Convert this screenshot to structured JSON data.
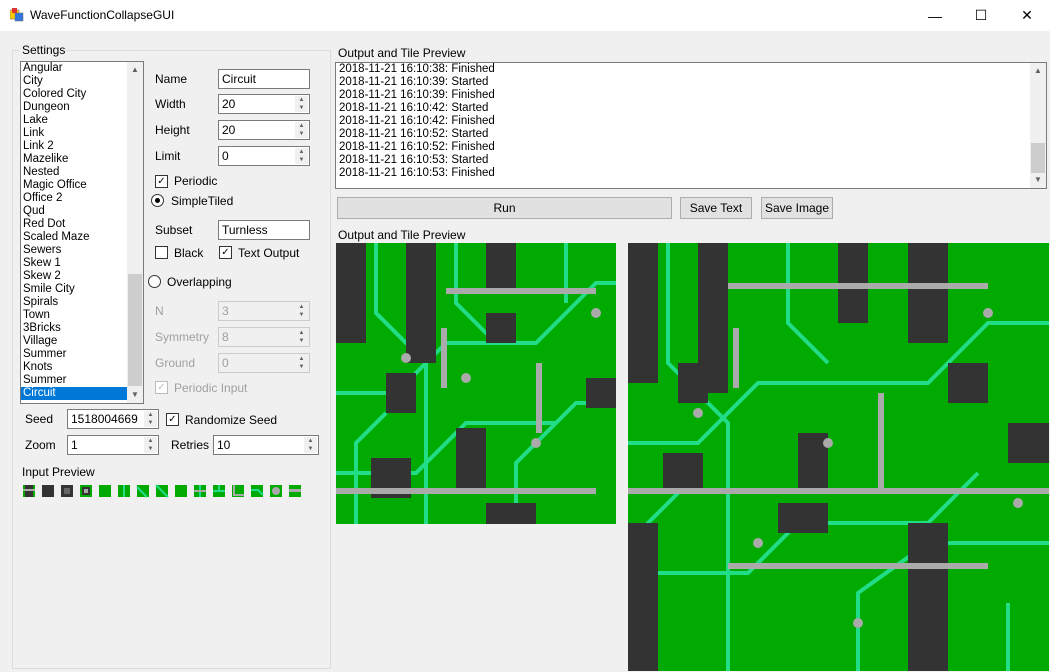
{
  "window": {
    "title": "WaveFunctionCollapseGUI",
    "minimize": "—",
    "maximize": "☐",
    "close": "✕"
  },
  "settings": {
    "group_label": "Settings",
    "list_items": [
      "Angular",
      "City",
      "Colored City",
      "Dungeon",
      "Lake",
      "Link",
      "Link 2",
      "Mazelike",
      "Nested",
      "Magic Office",
      "Office 2",
      "Qud",
      "Red Dot",
      "Scaled Maze",
      "Sewers",
      "Skew 1",
      "Skew 2",
      "Smile City",
      "Spirals",
      "Town",
      "3Bricks",
      "Village",
      "Summer",
      "Knots",
      "Summer",
      "Circuit"
    ],
    "selected_item": "Circuit",
    "name_label": "Name",
    "name_value": "Circuit",
    "width_label": "Width",
    "width_value": "20",
    "height_label": "Height",
    "height_value": "20",
    "limit_label": "Limit",
    "limit_value": "0",
    "periodic_label": "Periodic",
    "periodic_checked": "✓",
    "simpletiled_label": "SimpleTiled",
    "subset_label": "Subset",
    "subset_value": "Turnless",
    "black_label": "Black",
    "text_output_label": "Text Output",
    "text_output_checked": "✓",
    "overlapping_label": "Overlapping",
    "n_label": "N",
    "n_value": "3",
    "symmetry_label": "Symmetry",
    "symmetry_value": "8",
    "ground_label": "Ground",
    "ground_value": "0",
    "periodic_input_label": "Periodic Input",
    "periodic_input_checked": "✓",
    "seed_label": "Seed",
    "seed_value": "1518004669",
    "randomize_seed_label": "Randomize Seed",
    "randomize_seed_checked": "✓",
    "zoom_label": "Zoom",
    "zoom_value": "1",
    "retries_label": "Retries",
    "retries_value": "10",
    "input_preview_label": "Input Preview"
  },
  "output": {
    "group_label": "Output and Tile Preview",
    "log_lines": [
      "2018-11-21 16:10:38: Finished",
      "2018-11-21 16:10:39: Started",
      "2018-11-21 16:10:39: Finished",
      "2018-11-21 16:10:42: Started",
      "2018-11-21 16:10:42: Finished",
      "2018-11-21 16:10:52: Started",
      "2018-11-21 16:10:52: Finished",
      "2018-11-21 16:10:53: Started",
      "2018-11-21 16:10:53: Finished"
    ],
    "run_label": "Run",
    "save_text_label": "Save Text",
    "save_image_label": "Save Image",
    "preview_label": "Output and Tile Preview"
  },
  "colors": {
    "pcb_green": "#00aa00",
    "trace": "#22dd88",
    "chip": "#333333",
    "accent": "#0078d7"
  }
}
